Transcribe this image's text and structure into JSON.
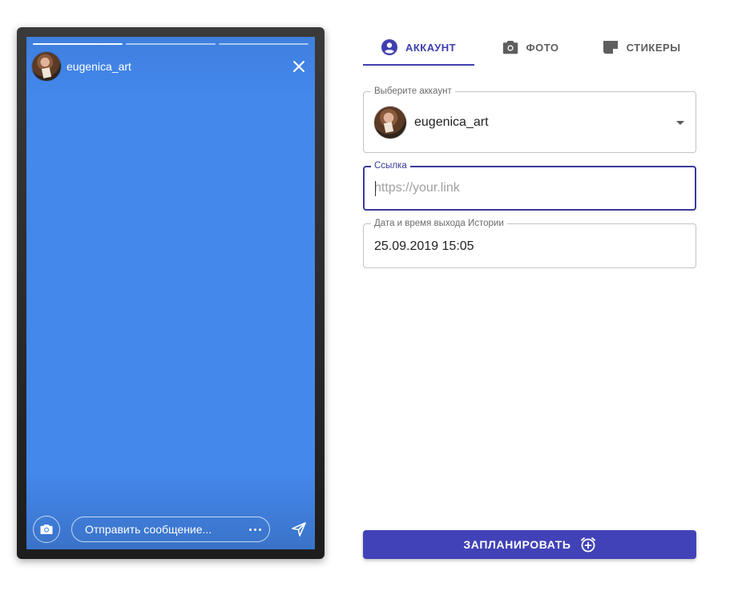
{
  "story": {
    "username": "eugenica_art",
    "message_placeholder": "Отправить сообщение...",
    "progress_segments": 3,
    "active_segment": 1
  },
  "tabs": [
    {
      "label": "АККАУНТ",
      "icon": "account-circle-icon",
      "active": true
    },
    {
      "label": "ФОТО",
      "icon": "camera-icon",
      "active": false
    },
    {
      "label": "СТИКЕРЫ",
      "icon": "sticker-icon",
      "active": false
    }
  ],
  "form": {
    "account_label": "Выберите аккаунт",
    "account_value": "eugenica_art",
    "link_label": "Ссылка",
    "link_placeholder": "https://your.link",
    "link_value": "",
    "date_label": "Дата и время выхода Истории",
    "date_value": "25.09.2019 15:05"
  },
  "actions": {
    "schedule_label": "ЗАПЛАНИРОВАТЬ",
    "schedule_icon": "alarm-add-icon"
  },
  "colors": {
    "accent": "#4242b8",
    "story_background": "#4488ec"
  }
}
